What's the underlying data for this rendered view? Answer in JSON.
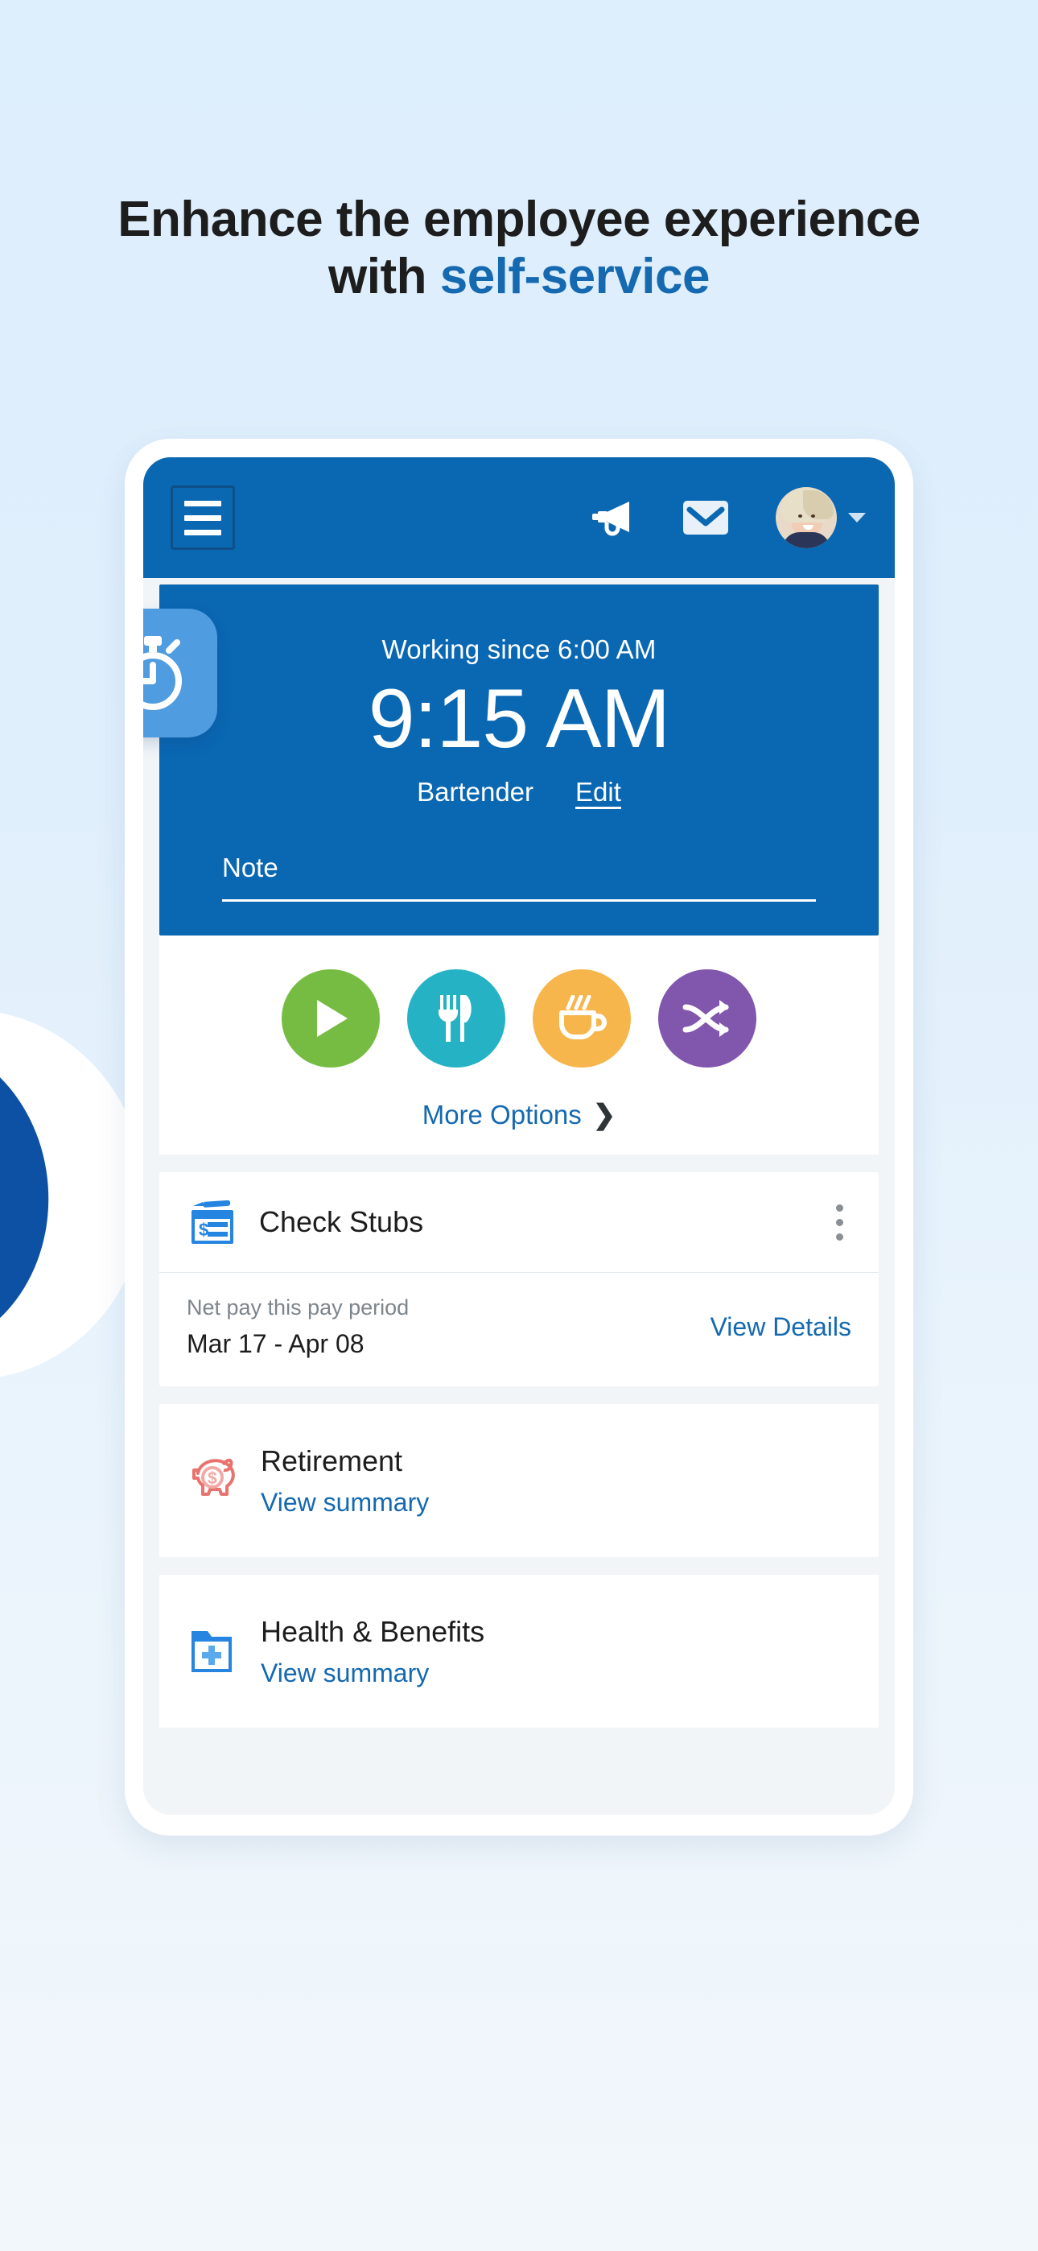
{
  "page": {
    "headline_line1": "Enhance the employee experience",
    "headline_line2_plain": "with ",
    "headline_line2_accent": "self-service",
    "accent_color": "#1569b0",
    "brand_blue": "#0a67b2"
  },
  "appbar": {
    "menu_label": "Menu",
    "announcement_icon": "megaphone-icon",
    "mail_icon": "envelope-icon",
    "avatar_alt": "User avatar",
    "chevron_icon": "chevron-down-icon"
  },
  "clock": {
    "working_since": "Working since 6:00 AM",
    "current_time": "9:15 AM",
    "role": "Bartender",
    "edit_label": "Edit",
    "note_label": "Note",
    "badge_icon": "stopwatch-icon"
  },
  "quick_actions": {
    "items": [
      {
        "name": "start-shift",
        "icon": "play-icon",
        "color": "#76bc43"
      },
      {
        "name": "meal-break",
        "icon": "utensils-icon",
        "color": "#24b2c4"
      },
      {
        "name": "coffee-break",
        "icon": "coffee-icon",
        "color": "#f7b64c"
      },
      {
        "name": "transfer",
        "icon": "shuffle-icon",
        "color": "#8156ad"
      }
    ],
    "more_label": "More Options",
    "more_chevron": "❯"
  },
  "check_stubs": {
    "title": "Check Stubs",
    "icon": "check-stub-icon",
    "menu_icon": "kebab-menu-icon",
    "net_pay_label": "Net pay this pay period",
    "pay_period": "Mar 17 - Apr 08",
    "view_details": "View Details"
  },
  "retirement": {
    "title": "Retirement",
    "link": "View summary",
    "icon": "piggy-bank-icon",
    "icon_color": "#e8736e"
  },
  "health_benefits": {
    "title": "Health & Benefits",
    "link": "View summary",
    "icon": "medical-folder-icon",
    "icon_color": "#2585e0"
  }
}
